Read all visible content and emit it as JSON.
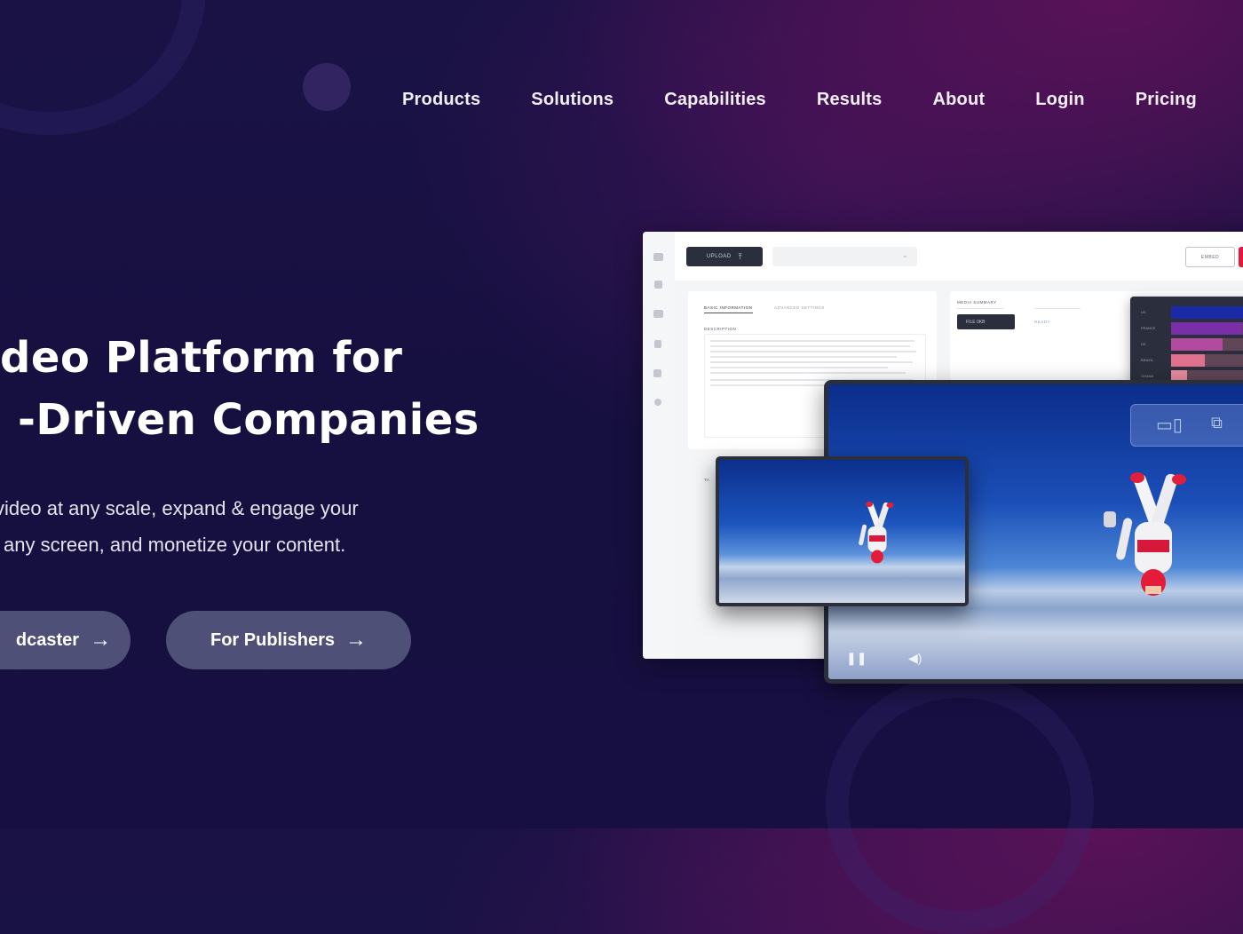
{
  "nav": {
    "items": [
      "Products",
      "Solutions",
      "Capabilities",
      "Results",
      "About",
      "Login",
      "Pricing"
    ]
  },
  "hero": {
    "title_line1": "deo Platform for",
    "title_line2": "-Driven Companies",
    "subtitle_line1": " video at any scale, expand & engage your",
    "subtitle_line2": "any screen, and monetize your content.",
    "cta_broadcaster": "dcaster",
    "cta_publishers": "For Publishers",
    "cta_arrow": "→"
  },
  "mockup": {
    "upload_label": "UPLOAD",
    "upload_icon": "upload-icon",
    "embed_label": "EMBED",
    "tabs": [
      "BASIC INFORMATION",
      "ADVANCED SETTINGS"
    ],
    "description_label": "DESCRIPTION",
    "media_summary_label": "MEDIA SUMMARY",
    "file_label": "FILE 0KB",
    "status_label": "READY",
    "analytics": {
      "labels": [
        "US",
        "FRANCE",
        "UK",
        "BRAZIL",
        "GHANA"
      ],
      "fill_fraction": [
        1.0,
        0.85,
        0.62,
        0.4,
        0.19
      ],
      "colors": [
        "#1b2aa8",
        "#7a2fa8",
        "#b24aa0",
        "#e0718f",
        "#e88ca0"
      ]
    },
    "colors": {
      "accent_red": "#e5173f",
      "dark_button": "#2b2f3d"
    }
  }
}
